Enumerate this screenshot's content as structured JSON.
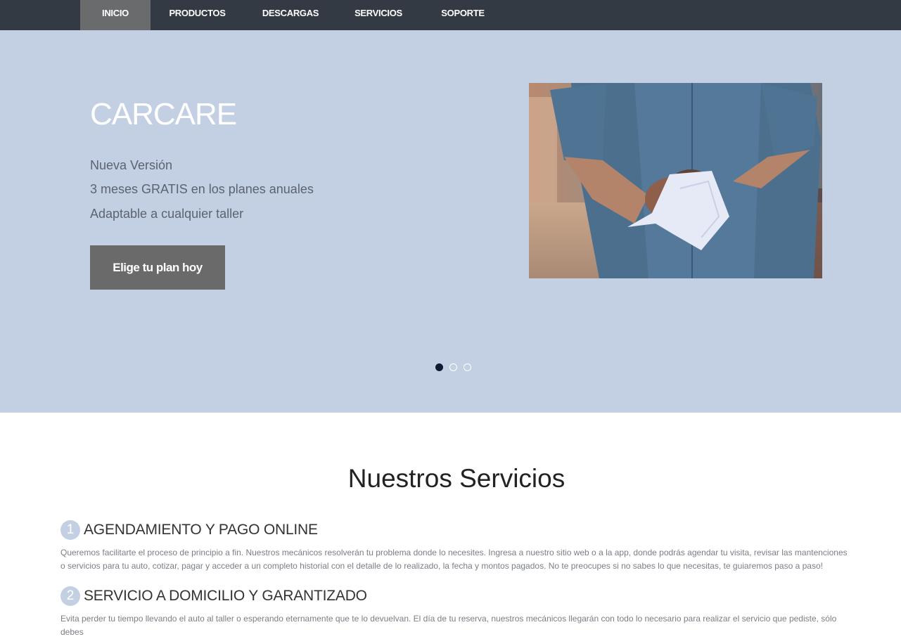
{
  "nav": {
    "items": [
      {
        "label": "INICIO"
      },
      {
        "label": "PRODUCTOS"
      },
      {
        "label": "DESCARGAS"
      },
      {
        "label": "SERVICIOS"
      },
      {
        "label": "SOPORTE"
      }
    ],
    "active_index": 0
  },
  "hero": {
    "title": "CARCARE",
    "lines": [
      "Nueva Versión",
      "3 meses GRATIS en los planes anuales",
      "Adaptable a cualquier taller"
    ],
    "cta_label": "Elige tu plan hoy",
    "image": "mechanic-wiping-hands-photo",
    "slides_count": 3,
    "active_slide": 1
  },
  "services": {
    "title": "Nuestros Servicios",
    "items": [
      {
        "number": "1",
        "title": "AGENDAMIENTO Y PAGO ONLINE",
        "text": "Queremos facilitarte el proceso de principio a fin. Nuestros mecánicos resolverán tu problema donde lo necesites. Ingresa a nuestro sitio web o a la app, donde podrás agendar tu visita, revisar las mantenciones o servicios para tu auto, cotizar, pagar y acceder a un completo historial con el detalle de lo realizado, la fecha y montos pagados. No te preocupes si no sabes lo que necesitas, te guiaremos paso a paso!"
      },
      {
        "number": "2",
        "title": "SERVICIO A DOMICILIO Y GARANTIZADO",
        "text": "Evita perder tu tiempo llevando el auto al taller o esperando eternamente que te lo devuelvan. El día de tu reserva, nuestros mecánicos llegarán con todo lo necesario para realizar el servicio que pediste, sólo debes"
      }
    ]
  },
  "colors": {
    "nav_bg": "#343a44",
    "nav_active": "#6a6b6d",
    "hero_bg": "#c3d0e3",
    "cta_bg": "#6a6a6a",
    "dot_active": "#0f1a33"
  }
}
